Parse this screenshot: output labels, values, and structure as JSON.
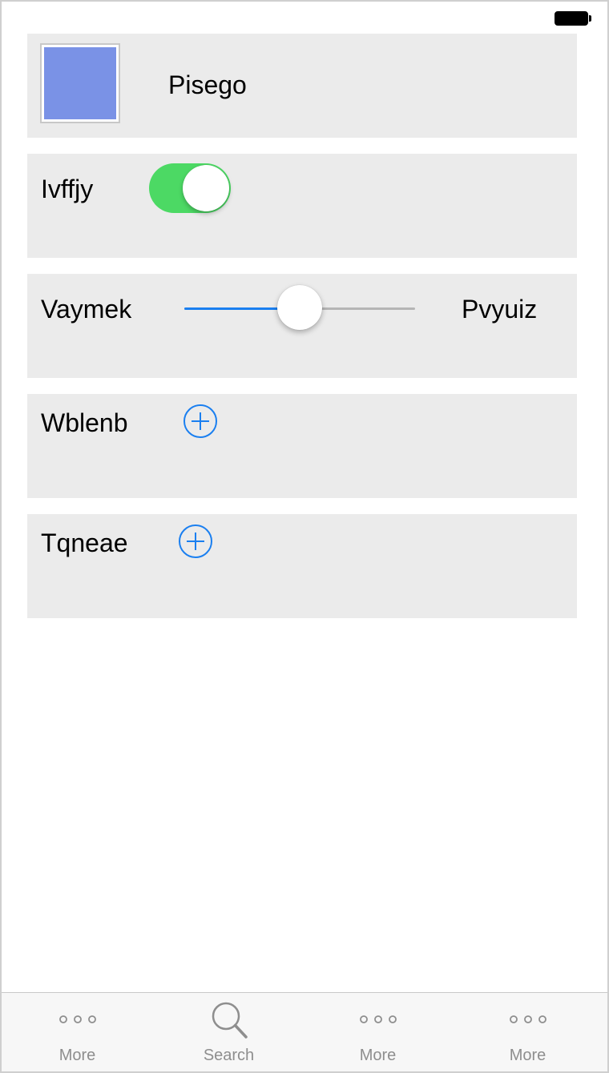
{
  "colors": {
    "card_background": "#ebebeb",
    "swatch": "#7a92e6",
    "toggle_on": "#4cd964",
    "accent_blue": "#1a7ff0",
    "tab_gray": "#8e8e8e"
  },
  "status_bar": {
    "battery_icon": "battery-full-icon"
  },
  "rows": {
    "color_row": {
      "label": "Pisego",
      "swatch_color": "#7a92e6"
    },
    "toggle_row": {
      "label": "Ivffjy",
      "toggle_on": true
    },
    "slider_row": {
      "label": "Vaymek",
      "value_label": "Pvyuiz",
      "slider_value": 0.5
    },
    "add_row_1": {
      "label": "Wblenb",
      "icon": "plus-circle-icon"
    },
    "add_row_2": {
      "label": "Tqneae",
      "icon": "plus-circle-icon"
    }
  },
  "tab_bar": {
    "tabs": [
      {
        "label": "More",
        "icon": "more-dots-icon"
      },
      {
        "label": "Search",
        "icon": "search-icon"
      },
      {
        "label": "More",
        "icon": "more-dots-icon"
      },
      {
        "label": "More",
        "icon": "more-dots-icon"
      }
    ]
  }
}
